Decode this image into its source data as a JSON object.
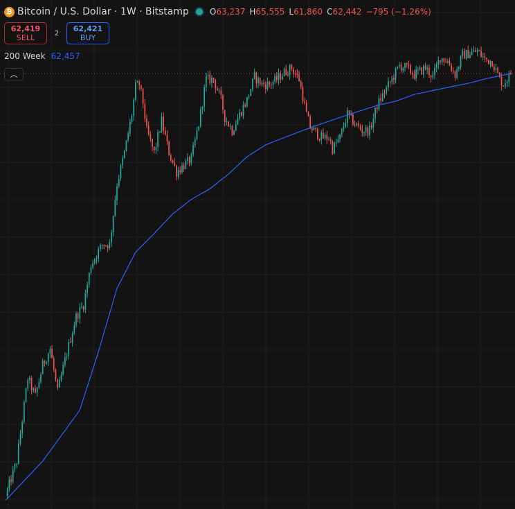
{
  "header": {
    "symbol": "Bitcoin / U.S. Dollar · 1W · Bitstamp",
    "icon": "bitcoin-icon",
    "open_label": "O",
    "open": "63,237",
    "high_label": "H",
    "high": "65,555",
    "low_label": "L",
    "low": "61,860",
    "close_label": "C",
    "close": "62,442",
    "change": "−795 (−1.26%)"
  },
  "trade": {
    "sell_price": "62,419",
    "sell_label": "SELL",
    "spread": "2",
    "buy_price": "62,421",
    "buy_label": "BUY"
  },
  "indicator": {
    "name": "200 Week",
    "value": "62,457"
  },
  "collapse_icon": "chevron-up-icon",
  "colors": {
    "background": "#131313",
    "grid": "#1f1f1f",
    "up": "#26a69a",
    "down": "#ef5350",
    "ma": "#2962ff"
  },
  "chart_data": {
    "type": "candlestick",
    "scale": "log",
    "ylim": [
      3100,
      78000
    ],
    "last_price_line": 62442,
    "price_anchors": [
      [
        0,
        3300
      ],
      [
        6,
        4200
      ],
      [
        12,
        7500
      ],
      [
        16,
        6600
      ],
      [
        20,
        8200
      ],
      [
        24,
        9200
      ],
      [
        28,
        6800
      ],
      [
        32,
        8500
      ],
      [
        38,
        11500
      ],
      [
        42,
        12500
      ],
      [
        46,
        16500
      ],
      [
        52,
        19000
      ],
      [
        56,
        19000
      ],
      [
        60,
        29000
      ],
      [
        64,
        36000
      ],
      [
        68,
        47000
      ],
      [
        70,
        57000
      ],
      [
        72,
        58000
      ],
      [
        74,
        51000
      ],
      [
        76,
        42000
      ],
      [
        80,
        36000
      ],
      [
        84,
        45000
      ],
      [
        88,
        36000
      ],
      [
        92,
        31500
      ],
      [
        96,
        33000
      ],
      [
        100,
        34500
      ],
      [
        104,
        44000
      ],
      [
        108,
        60000
      ],
      [
        112,
        60000
      ],
      [
        116,
        52000
      ],
      [
        118,
        46000
      ],
      [
        122,
        42000
      ],
      [
        126,
        47000
      ],
      [
        130,
        52000
      ],
      [
        134,
        61000
      ],
      [
        138,
        58000
      ],
      [
        142,
        58000
      ],
      [
        146,
        60000
      ],
      [
        150,
        63000
      ],
      [
        154,
        65000
      ],
      [
        158,
        60000
      ],
      [
        162,
        47000
      ],
      [
        164,
        43000
      ],
      [
        166,
        42000
      ],
      [
        170,
        40000
      ],
      [
        174,
        40000
      ],
      [
        176,
        37000
      ],
      [
        180,
        40000
      ],
      [
        184,
        47000
      ],
      [
        188,
        44000
      ],
      [
        192,
        42000
      ],
      [
        196,
        42000
      ],
      [
        200,
        50000
      ],
      [
        204,
        55000
      ],
      [
        208,
        60000
      ],
      [
        212,
        66000
      ],
      [
        216,
        65000
      ],
      [
        220,
        62000
      ],
      [
        226,
        65000
      ],
      [
        230,
        61000
      ],
      [
        234,
        70000
      ],
      [
        238,
        68000
      ],
      [
        242,
        62000
      ],
      [
        246,
        71000
      ],
      [
        250,
        72000
      ],
      [
        254,
        73000
      ],
      [
        258,
        69000
      ],
      [
        262,
        68000
      ],
      [
        266,
        60000
      ],
      [
        268,
        58000
      ],
      [
        272,
        62442
      ]
    ],
    "ma200_anchors": [
      [
        0,
        3200
      ],
      [
        20,
        4200
      ],
      [
        40,
        6000
      ],
      [
        50,
        9000
      ],
      [
        60,
        14000
      ],
      [
        70,
        18000
      ],
      [
        80,
        20500
      ],
      [
        90,
        23500
      ],
      [
        100,
        26000
      ],
      [
        110,
        28000
      ],
      [
        120,
        31000
      ],
      [
        130,
        35000
      ],
      [
        140,
        38000
      ],
      [
        150,
        40000
      ],
      [
        160,
        42000
      ],
      [
        170,
        44000
      ],
      [
        180,
        46000
      ],
      [
        190,
        48000
      ],
      [
        200,
        50000
      ],
      [
        210,
        51500
      ],
      [
        220,
        54000
      ],
      [
        230,
        55500
      ],
      [
        240,
        57000
      ],
      [
        250,
        58500
      ],
      [
        260,
        60500
      ],
      [
        272,
        62457
      ]
    ]
  }
}
